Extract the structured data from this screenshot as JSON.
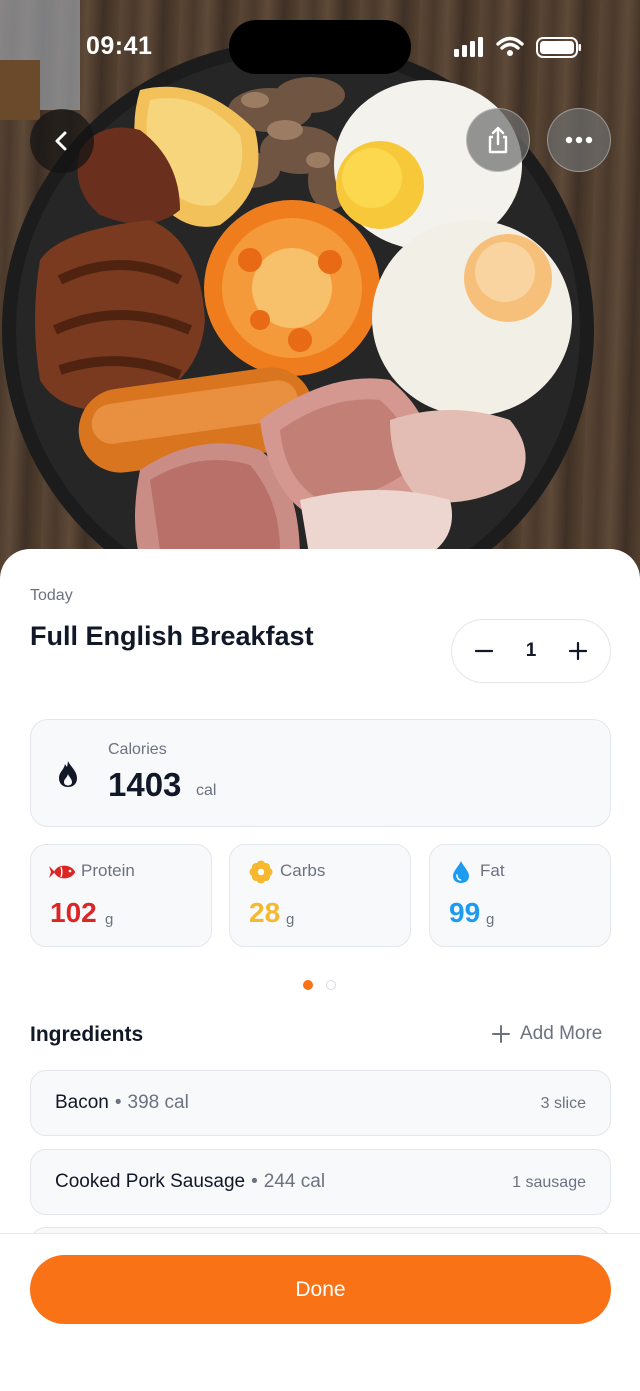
{
  "status_bar": {
    "time": "09:41"
  },
  "hero": {
    "photo": "full-english-breakfast-photo"
  },
  "header": {
    "date": "Today",
    "title": "Full English Breakfast"
  },
  "quantity": {
    "value": "1"
  },
  "calories": {
    "label": "Calories",
    "value": "1403",
    "unit": "cal"
  },
  "macros": {
    "protein": {
      "label": "Protein",
      "value": "102",
      "unit": "g",
      "color": "#dc2626",
      "icon": "fish-icon"
    },
    "carbs": {
      "label": "Carbs",
      "value": "28",
      "unit": "g",
      "color": "#f5b82e",
      "icon": "flower-icon"
    },
    "fat": {
      "label": "Fat",
      "value": "99",
      "unit": "g",
      "color": "#1d9bf0",
      "icon": "water-drop-icon"
    }
  },
  "pager": {
    "pages": 2,
    "active": 1
  },
  "ingredients": {
    "title": "Ingredients",
    "add_more": "Add More",
    "items": [
      {
        "name": "Bacon",
        "calories": "398 cal",
        "quantity": "3 slice"
      },
      {
        "name": "Cooked Pork Sausage",
        "calories": "244 cal",
        "quantity": "1 sausage"
      },
      {
        "name": "",
        "calories": "",
        "quantity": ""
      }
    ]
  },
  "actions": {
    "done": "Done"
  },
  "colors": {
    "accent": "#f97316"
  }
}
